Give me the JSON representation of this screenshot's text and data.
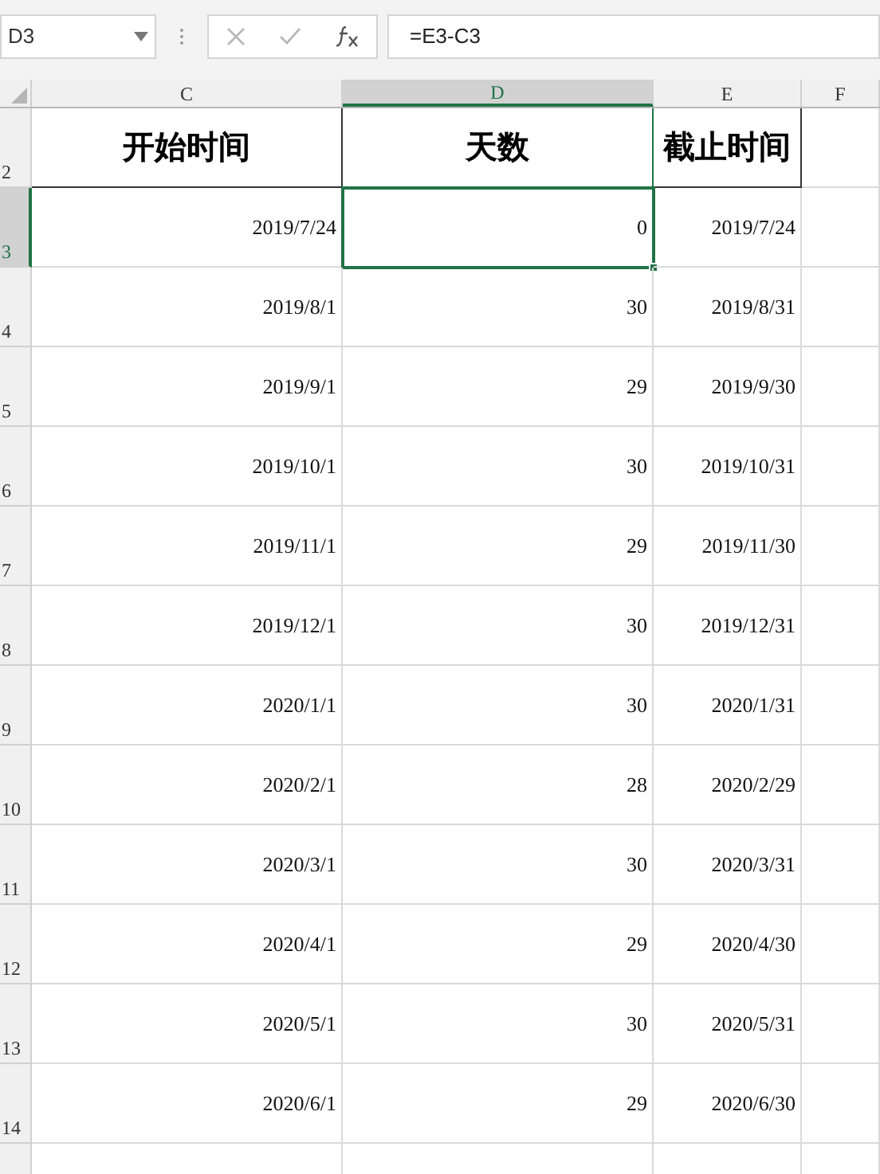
{
  "name_box": "D3",
  "formula_buttons": [
    {
      "kind": "cancel",
      "disabled": true
    },
    {
      "kind": "enter",
      "disabled": true
    },
    {
      "kind": "function",
      "disabled": false
    }
  ],
  "formula": "=E3-C3",
  "columns": [
    {
      "label": "C",
      "selected": false
    },
    {
      "label": "D",
      "selected": true
    },
    {
      "label": "E",
      "selected": false
    },
    {
      "label": "F",
      "selected": false
    }
  ],
  "rows": [
    {
      "number": "2",
      "selected": false,
      "kind": "header",
      "cells": [
        "开始时间",
        "天数",
        "截止时间",
        ""
      ]
    },
    {
      "number": "3",
      "selected": true,
      "kind": "data",
      "cells": [
        "2019/7/24",
        "0",
        "2019/7/24",
        ""
      ]
    },
    {
      "number": "4",
      "selected": false,
      "kind": "data",
      "cells": [
        "2019/8/1",
        "30",
        "2019/8/31",
        ""
      ]
    },
    {
      "number": "5",
      "selected": false,
      "kind": "data",
      "cells": [
        "2019/9/1",
        "29",
        "2019/9/30",
        ""
      ]
    },
    {
      "number": "6",
      "selected": false,
      "kind": "data",
      "cells": [
        "2019/10/1",
        "30",
        "2019/10/31",
        ""
      ]
    },
    {
      "number": "7",
      "selected": false,
      "kind": "data",
      "cells": [
        "2019/11/1",
        "29",
        "2019/11/30",
        ""
      ]
    },
    {
      "number": "8",
      "selected": false,
      "kind": "data",
      "cells": [
        "2019/12/1",
        "30",
        "2019/12/31",
        ""
      ]
    },
    {
      "number": "9",
      "selected": false,
      "kind": "data",
      "cells": [
        "2020/1/1",
        "30",
        "2020/1/31",
        ""
      ]
    },
    {
      "number": "10",
      "selected": false,
      "kind": "data",
      "cells": [
        "2020/2/1",
        "28",
        "2020/2/29",
        ""
      ]
    },
    {
      "number": "11",
      "selected": false,
      "kind": "data",
      "cells": [
        "2020/3/1",
        "30",
        "2020/3/31",
        ""
      ]
    },
    {
      "number": "12",
      "selected": false,
      "kind": "data",
      "cells": [
        "2020/4/1",
        "29",
        "2020/4/30",
        ""
      ]
    },
    {
      "number": "13",
      "selected": false,
      "kind": "data",
      "cells": [
        "2020/5/1",
        "30",
        "2020/5/31",
        ""
      ]
    },
    {
      "number": "14",
      "selected": false,
      "kind": "data",
      "cells": [
        "2020/6/1",
        "29",
        "2020/6/30",
        ""
      ]
    }
  ]
}
